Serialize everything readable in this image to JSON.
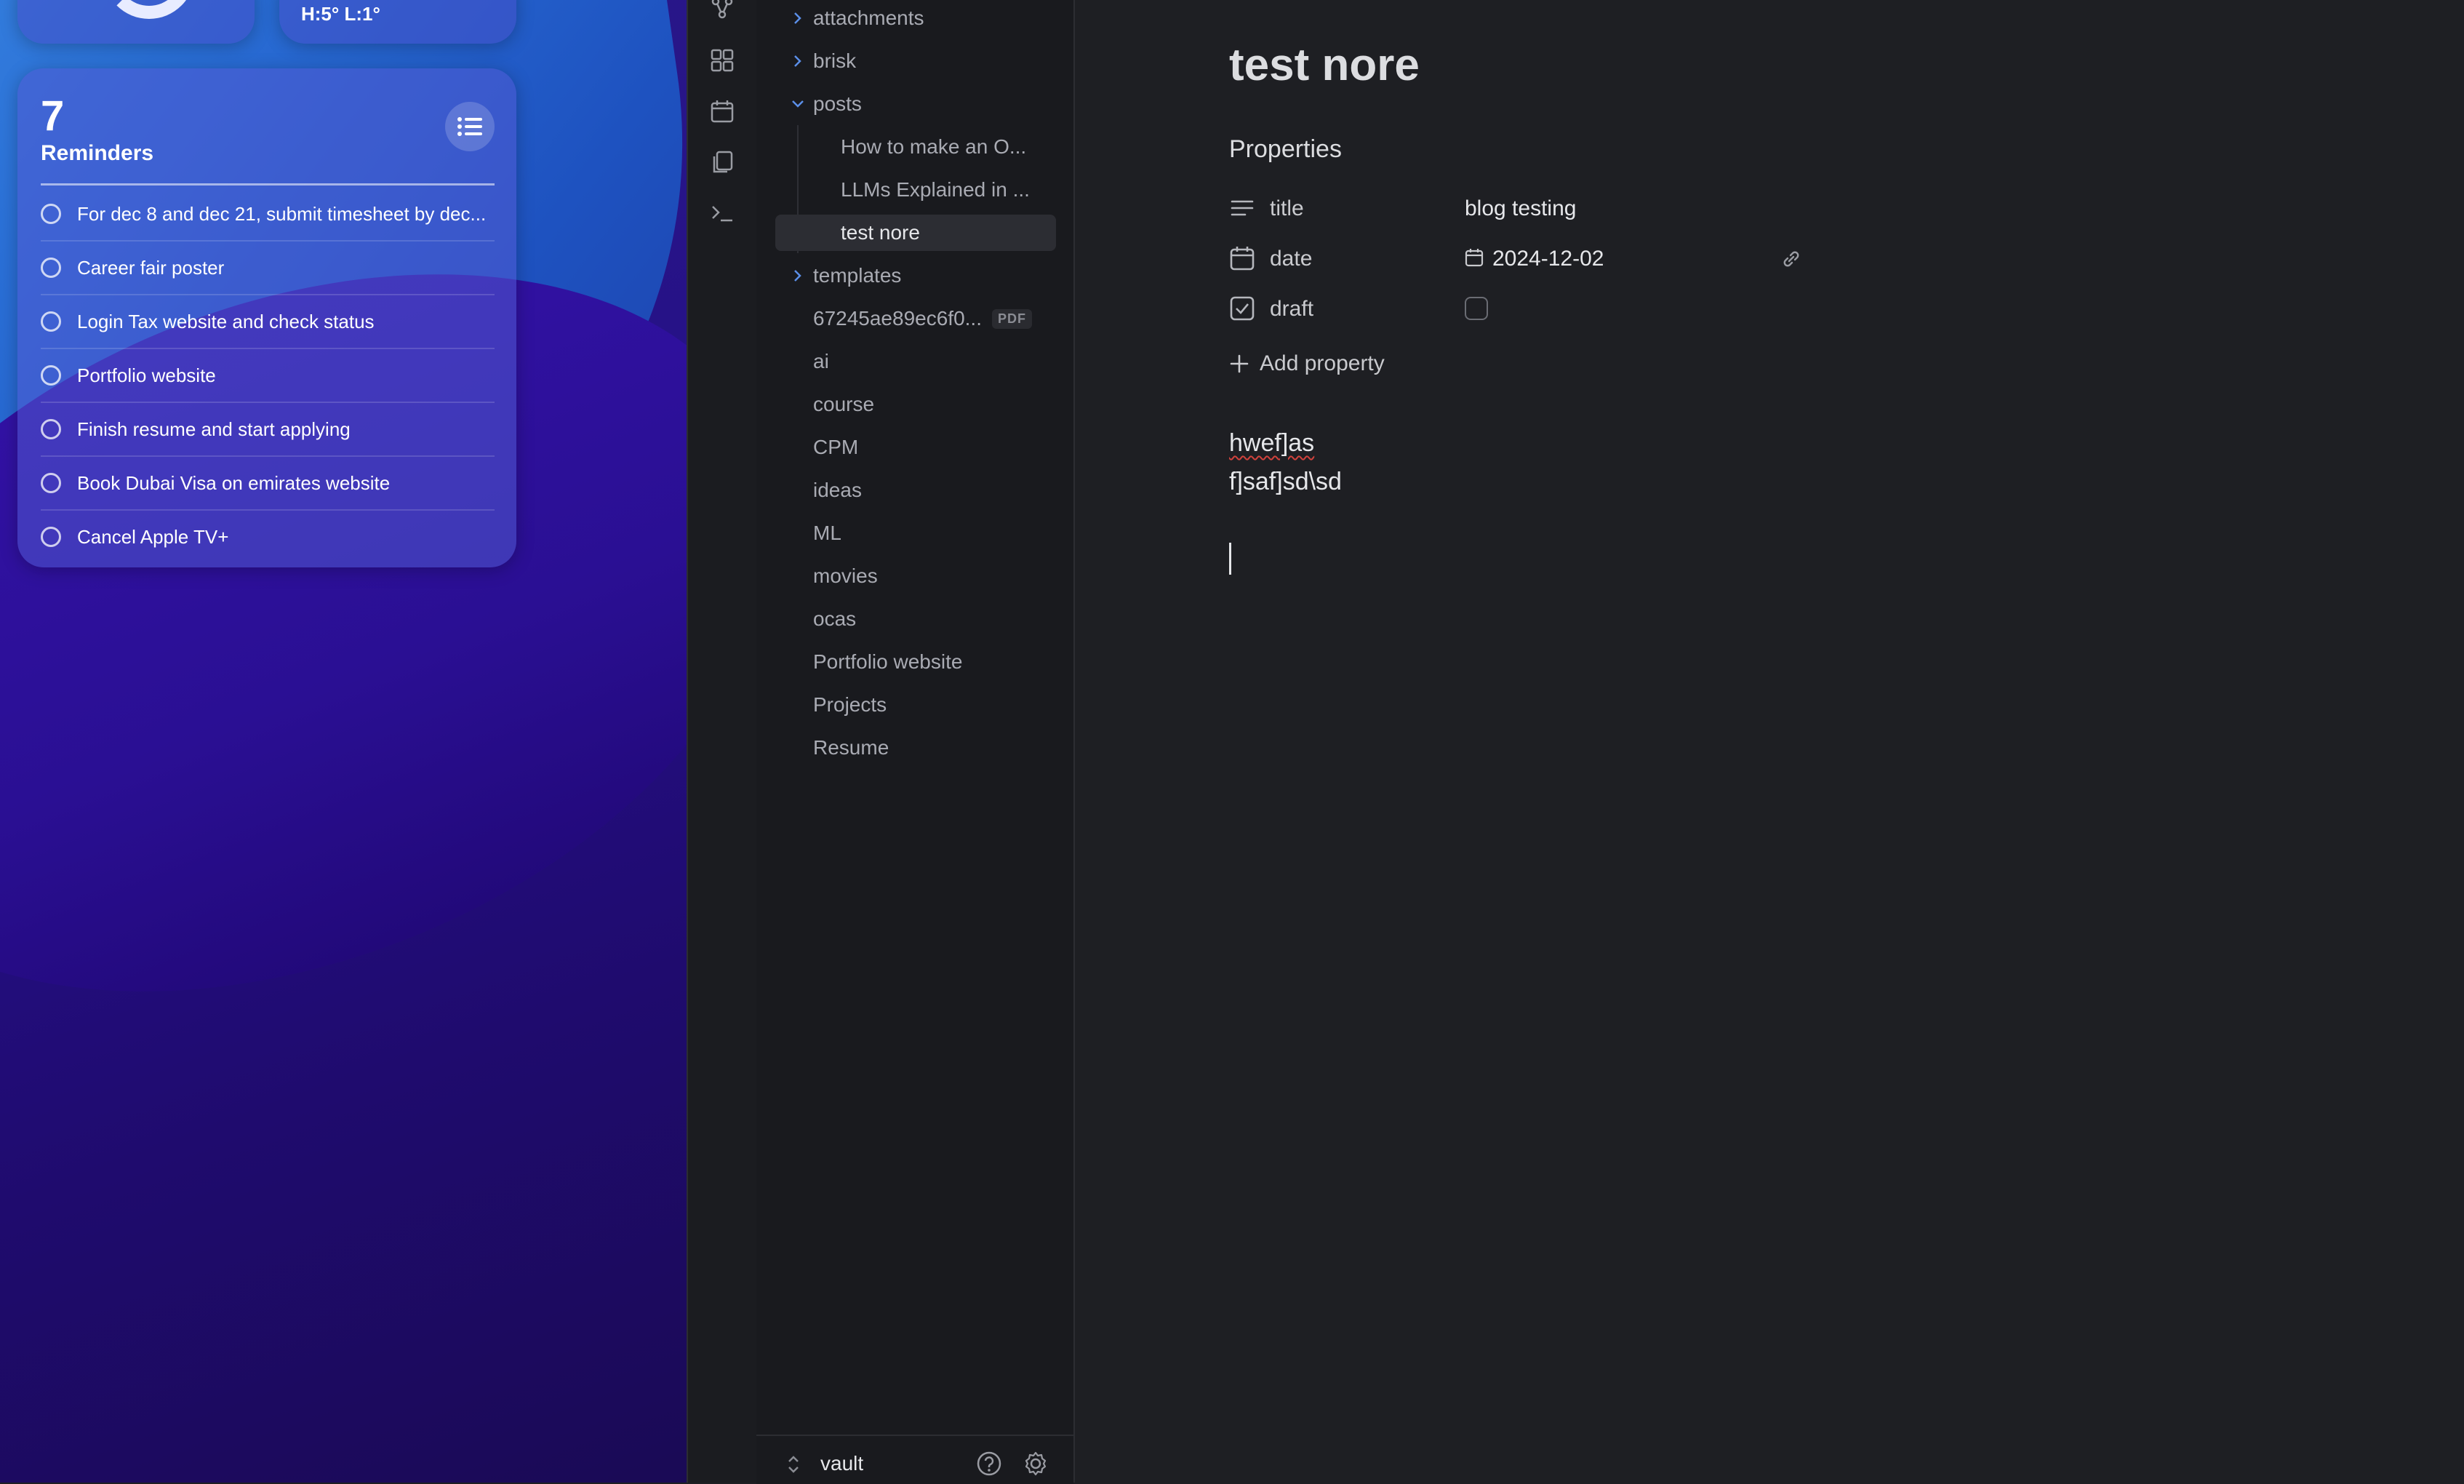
{
  "desktop": {
    "weather": {
      "high_low": "H:5° L:1°"
    },
    "reminders": {
      "count": "7",
      "title": "Reminders",
      "items": [
        "For dec 8 and dec 21, submit timesheet by dec...",
        "Career fair poster",
        "Login Tax website and check status",
        "Portfolio website",
        "Finish resume and start applying",
        "Book Dubai Visa on emirates website",
        "Cancel Apple TV+"
      ]
    }
  },
  "ribbon": {
    "icons": [
      "graph-icon",
      "canvas-icon",
      "calendar-icon",
      "copy-icon",
      "terminal-icon"
    ]
  },
  "explorer": {
    "folders": {
      "attachments": "attachments",
      "brisk": "brisk",
      "posts": "posts",
      "templates": "templates"
    },
    "posts_children": {
      "item1": "How to make an O...",
      "item2": "LLMs Explained in ...",
      "item3": "test nore"
    },
    "files": {
      "pdf_name": "67245ae89ec6f0...",
      "pdf_badge": "PDF",
      "ai": "ai",
      "course": "course",
      "cpm": "CPM",
      "ideas": "ideas",
      "ml": "ML",
      "movies": "movies",
      "ocas": "ocas",
      "portfolio": "Portfolio website",
      "projects": "Projects",
      "resume": "Resume"
    },
    "vault_name": "vault"
  },
  "editor": {
    "title": "test nore",
    "properties_heading": "Properties",
    "properties": {
      "title_key": "title",
      "title_value": "blog testing",
      "date_key": "date",
      "date_value": "2024-12-02",
      "draft_key": "draft"
    },
    "add_property": "Add property",
    "body": {
      "line1": "hwef]as",
      "line2": "f]saf]sd\\sd"
    }
  }
}
